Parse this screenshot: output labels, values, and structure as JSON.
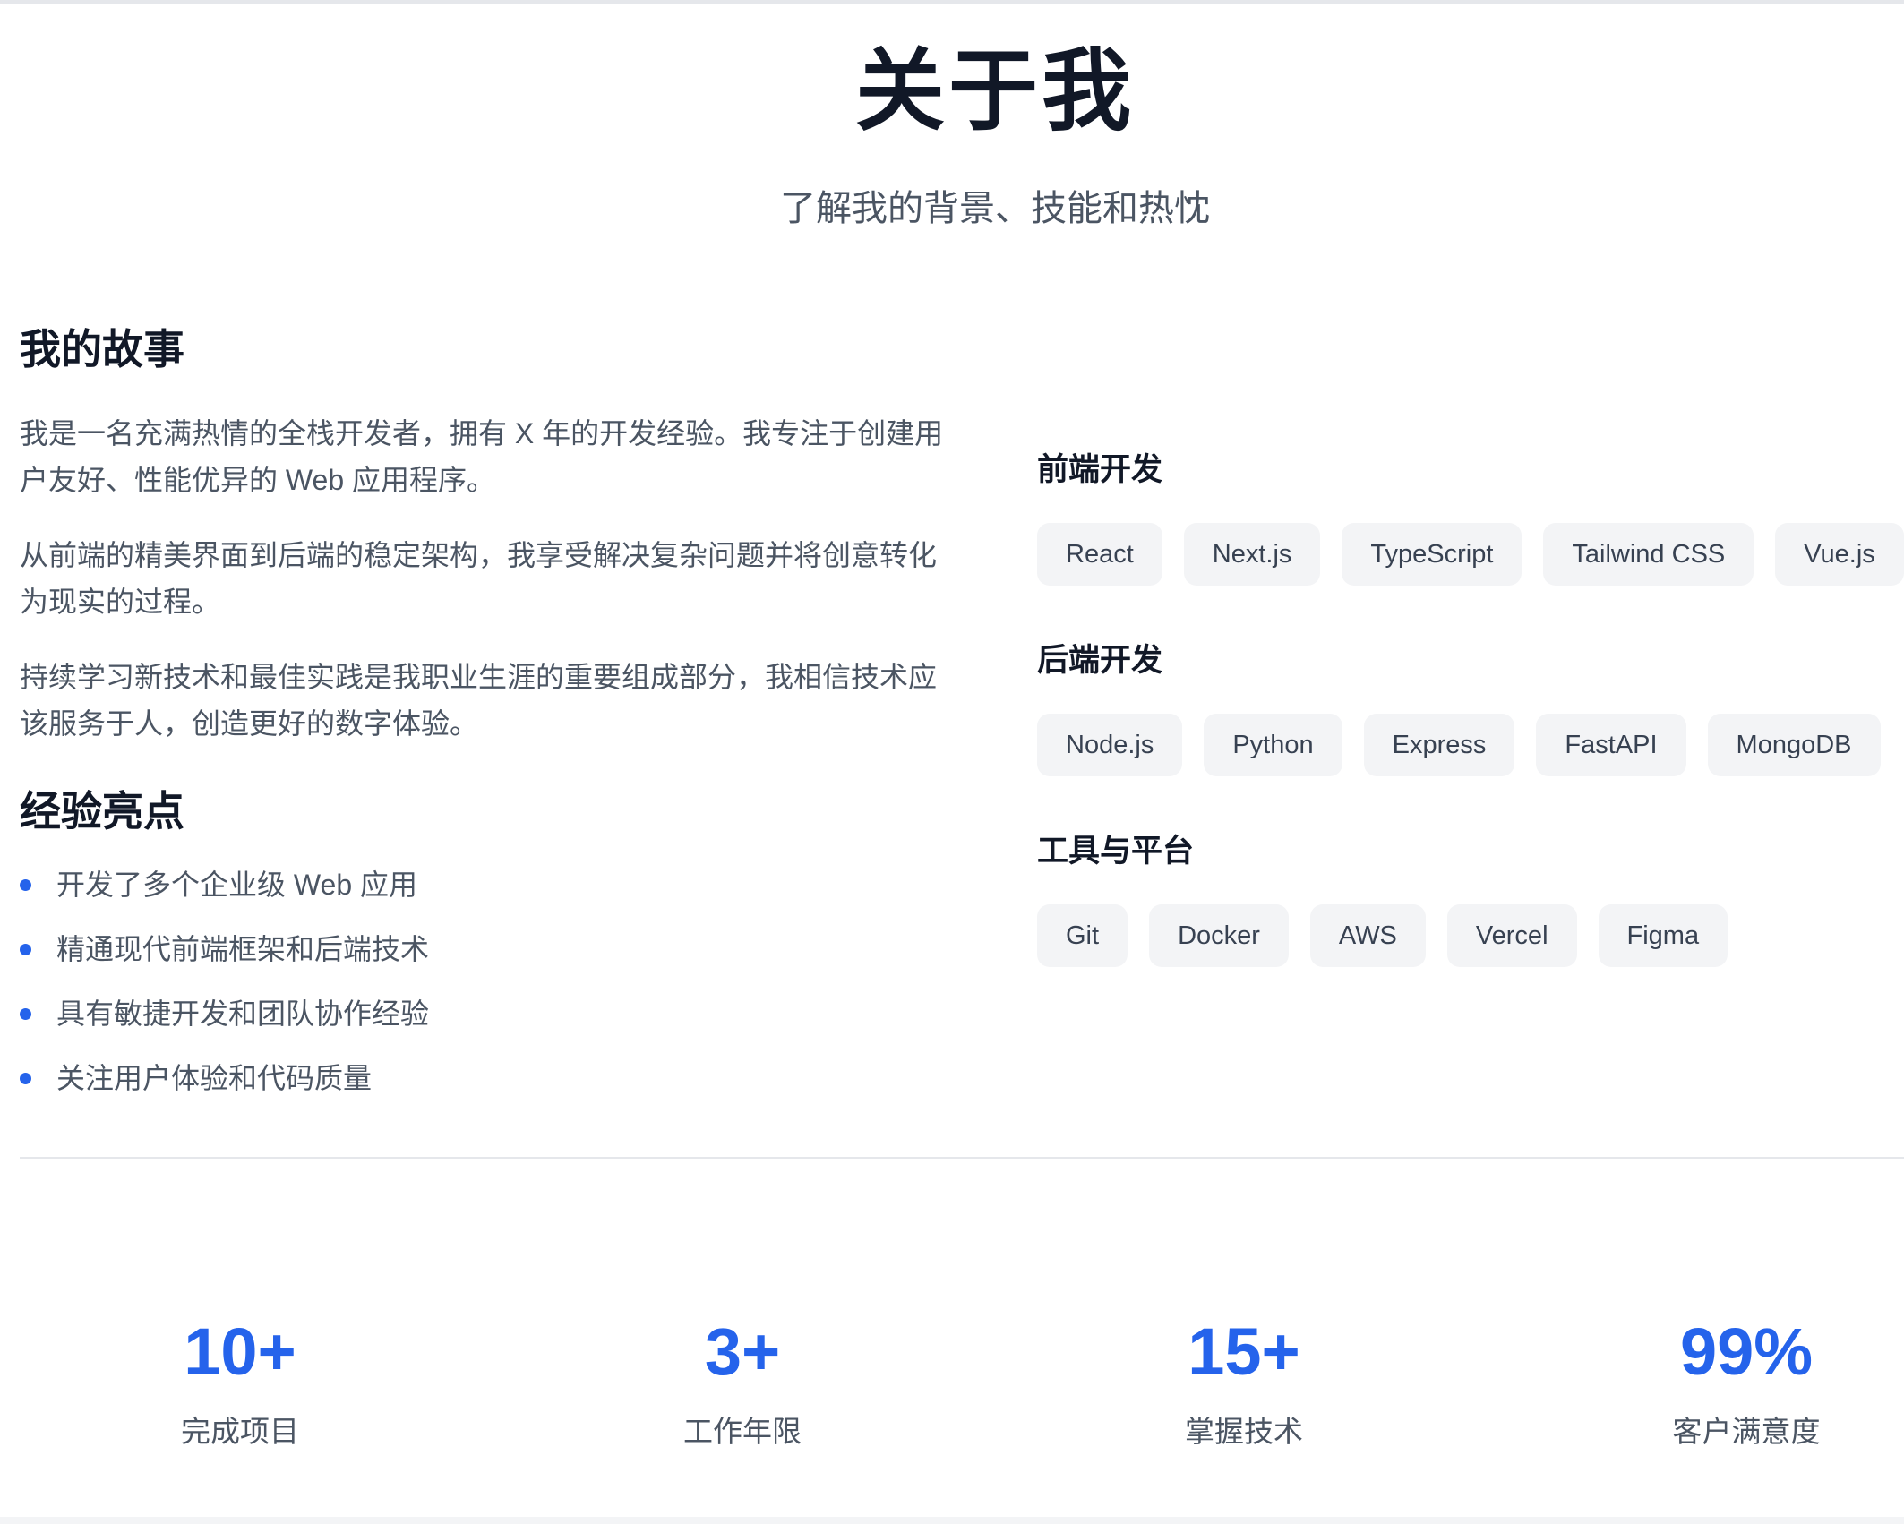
{
  "header": {
    "title": "关于我",
    "subtitle": "了解我的背景、技能和热忱"
  },
  "story": {
    "title": "我的故事",
    "paragraphs": [
      "我是一名充满热情的全栈开发者，拥有 X 年的开发经验。我专注于创建用户友好、性能优异的 Web 应用程序。",
      "从前端的精美界面到后端的稳定架构，我享受解决复杂问题并将创意转化为现实的过程。",
      "持续学习新技术和最佳实践是我职业生涯的重要组成部分，我相信技术应该服务于人，创造更好的数字体验。"
    ]
  },
  "experience": {
    "title": "经验亮点",
    "items": [
      "开发了多个企业级 Web 应用",
      "精通现代前端框架和后端技术",
      "具有敏捷开发和团队协作经验",
      "关注用户体验和代码质量"
    ]
  },
  "skills": [
    {
      "title": "前端开发",
      "tags": [
        "React",
        "Next.js",
        "TypeScript",
        "Tailwind CSS",
        "Vue.js"
      ]
    },
    {
      "title": "后端开发",
      "tags": [
        "Node.js",
        "Python",
        "Express",
        "FastAPI",
        "MongoDB"
      ]
    },
    {
      "title": "工具与平台",
      "tags": [
        "Git",
        "Docker",
        "AWS",
        "Vercel",
        "Figma"
      ]
    }
  ],
  "stats": [
    {
      "value": "10+",
      "label": "完成项目"
    },
    {
      "value": "3+",
      "label": "工作年限"
    },
    {
      "value": "15+",
      "label": "掌握技术"
    },
    {
      "value": "99%",
      "label": "客户满意度"
    }
  ],
  "colors": {
    "accent": "#2563eb",
    "heading": "#111827",
    "body_text": "#4b5563",
    "tag_bg": "#f3f4f6"
  }
}
